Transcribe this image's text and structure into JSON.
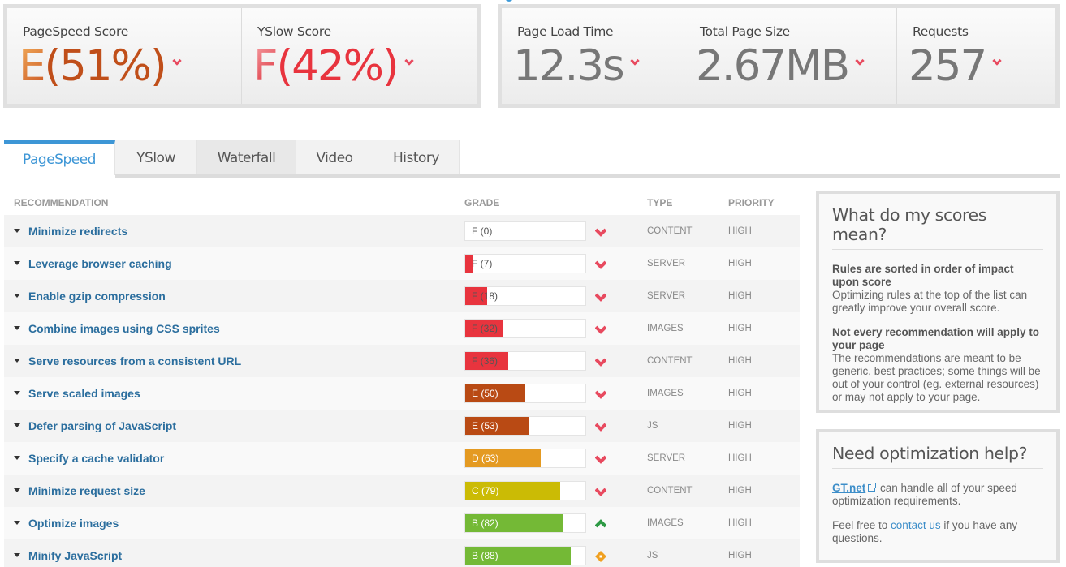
{
  "summary": {
    "pagespeed": {
      "label": "PageSpeed Score",
      "grade": "E",
      "value": "(51%)",
      "trend": "down"
    },
    "yslow": {
      "label": "YSlow Score",
      "grade": "F",
      "value": "(42%)",
      "trend": "down"
    },
    "load_time": {
      "label": "Page Load Time",
      "value": "12.3s",
      "trend": "down"
    },
    "page_size": {
      "label": "Total Page Size",
      "value": "2.67MB",
      "trend": "down"
    },
    "requests": {
      "label": "Requests",
      "value": "257",
      "trend": "down"
    }
  },
  "tabs": [
    {
      "label": "PageSpeed",
      "active": true
    },
    {
      "label": "YSlow",
      "active": false
    },
    {
      "label": "Waterfall",
      "active": false
    },
    {
      "label": "Video",
      "active": false
    },
    {
      "label": "History",
      "active": false
    }
  ],
  "table": {
    "headers": {
      "recommendation": "RECOMMENDATION",
      "grade": "GRADE",
      "type": "TYPE",
      "priority": "PRIORITY"
    },
    "rows": [
      {
        "name": "Minimize redirects",
        "grade": "F (0)",
        "score": 0,
        "trend": "down",
        "type": "CONTENT",
        "priority": "HIGH"
      },
      {
        "name": "Leverage browser caching",
        "grade": "F (7)",
        "score": 7,
        "trend": "down",
        "type": "SERVER",
        "priority": "HIGH"
      },
      {
        "name": "Enable gzip compression",
        "grade": "F (18)",
        "score": 18,
        "trend": "down",
        "type": "SERVER",
        "priority": "HIGH"
      },
      {
        "name": "Combine images using CSS sprites",
        "grade": "F (32)",
        "score": 32,
        "trend": "down",
        "type": "IMAGES",
        "priority": "HIGH"
      },
      {
        "name": "Serve resources from a consistent URL",
        "grade": "F (36)",
        "score": 36,
        "trend": "down",
        "type": "CONTENT",
        "priority": "HIGH"
      },
      {
        "name": "Serve scaled images",
        "grade": "E (50)",
        "score": 50,
        "trend": "down",
        "type": "IMAGES",
        "priority": "HIGH"
      },
      {
        "name": "Defer parsing of JavaScript",
        "grade": "E (53)",
        "score": 53,
        "trend": "down",
        "type": "JS",
        "priority": "HIGH"
      },
      {
        "name": "Specify a cache validator",
        "grade": "D (63)",
        "score": 63,
        "trend": "down",
        "type": "SERVER",
        "priority": "HIGH"
      },
      {
        "name": "Minimize request size",
        "grade": "C (79)",
        "score": 79,
        "trend": "down",
        "type": "CONTENT",
        "priority": "HIGH"
      },
      {
        "name": "Optimize images",
        "grade": "B (82)",
        "score": 82,
        "trend": "up",
        "type": "IMAGES",
        "priority": "HIGH"
      },
      {
        "name": "Minify JavaScript",
        "grade": "B (88)",
        "score": 88,
        "trend": "neutral",
        "type": "JS",
        "priority": "HIGH"
      }
    ]
  },
  "grade_colors": {
    "F": "#e8343e",
    "E": "#b94a14",
    "D": "#e49a22",
    "C": "#cbbb05",
    "B": "#74b936",
    "trend_down": "#e84a5f",
    "trend_up": "#2e9a45",
    "trend_neutral": "#f0a020"
  },
  "sidebar": {
    "scores_box": {
      "title": "What do my scores mean?",
      "p1_bold": "Rules are sorted in order of impact upon score",
      "p1_text": "Optimizing rules at the top of the list can greatly improve your overall score.",
      "p2_bold": "Not every recommendation will apply to your page",
      "p2_text": "The recommendations are meant to be generic, best practices; some things will be out of your control (eg. external resources) or may not apply to your page."
    },
    "help_box": {
      "title": "Need optimization help?",
      "link1": "GT.net",
      "p1_text": " can handle all of your speed optimization requirements.",
      "p2_prefix": "Feel free to ",
      "link2": "contact us",
      "p2_suffix": " if you have any questions."
    }
  }
}
